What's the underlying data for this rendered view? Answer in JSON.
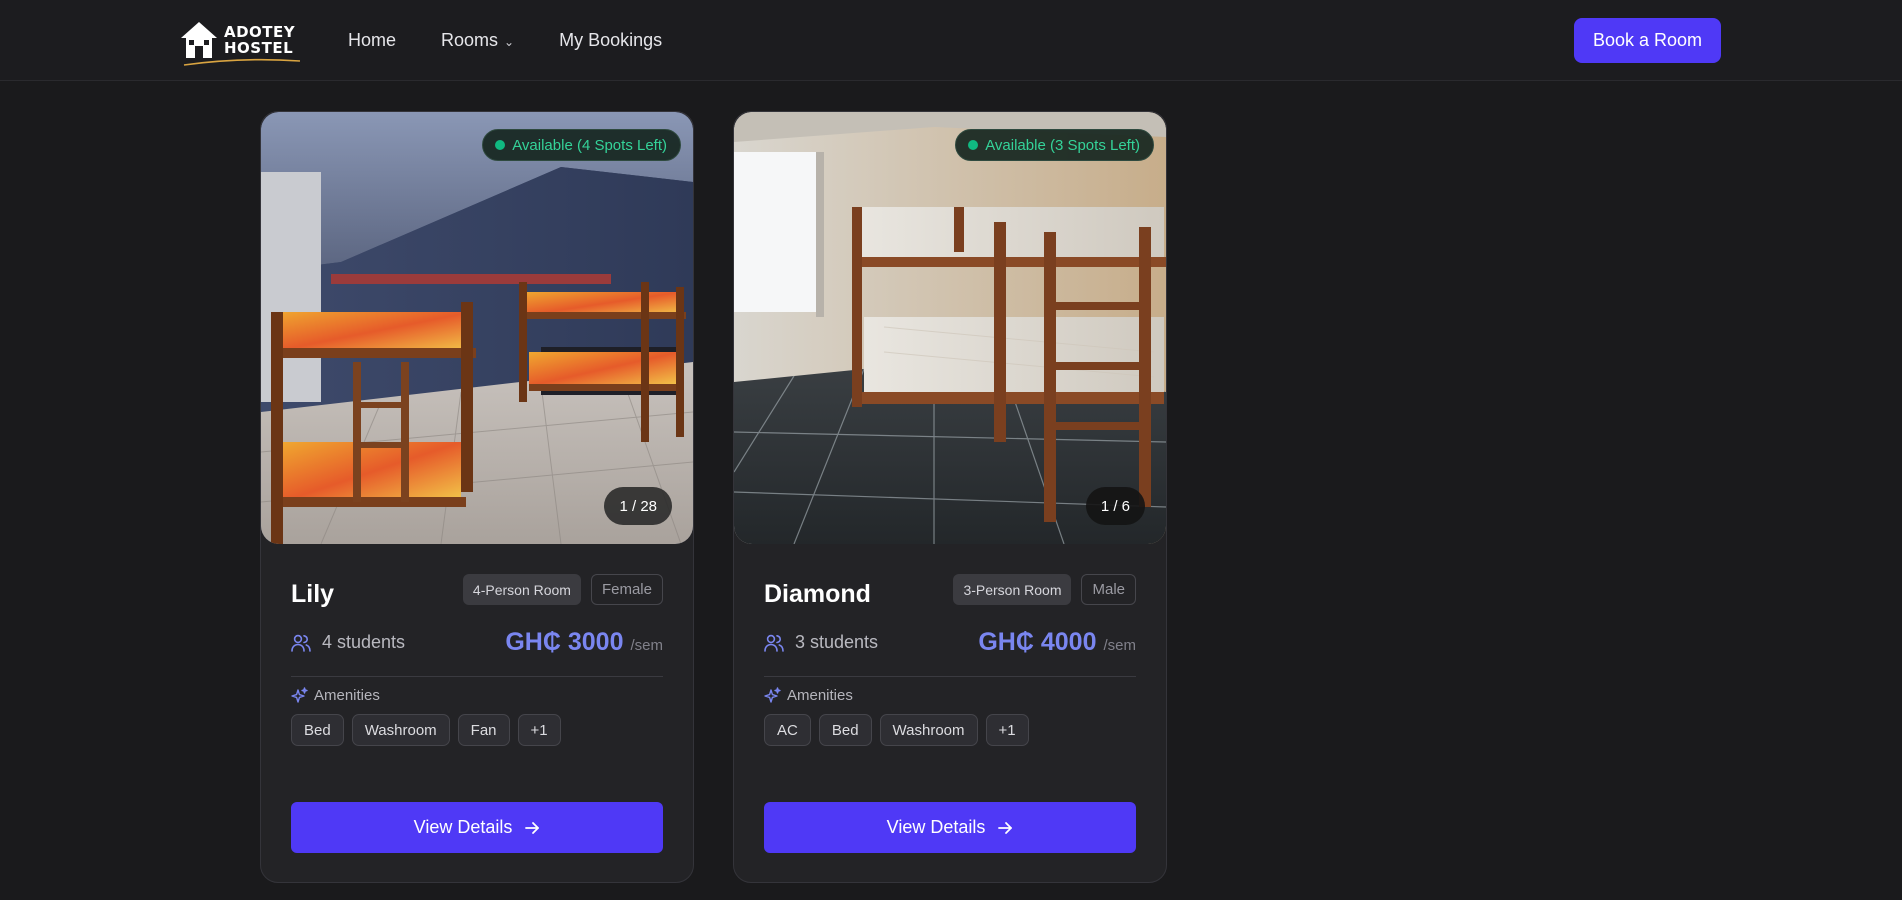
{
  "header": {
    "logo_line1": "ADOTEY",
    "logo_line2": "HOSTEL",
    "nav": [
      {
        "label": "Home"
      },
      {
        "label": "Rooms",
        "has_dropdown": true,
        "dropdown_icon": "chevron-down-icon"
      },
      {
        "label": "My Bookings"
      }
    ],
    "cta_label": "Book a Room"
  },
  "colors": {
    "accent": "#4f39f6",
    "price": "#7a86f0",
    "available": "#10b981",
    "background": "#1a1a1c",
    "card": "#232326"
  },
  "rooms": [
    {
      "name": "Lily",
      "availability": "Available (4 Spots Left)",
      "image_counter": "1 / 28",
      "type": "4-Person Room",
      "gender": "Female",
      "students": "4 students",
      "price": "GH₵ 3000",
      "price_unit": "/sem",
      "amenities_label": "Amenities",
      "amenities": [
        "Bed",
        "Washroom",
        "Fan",
        "+1"
      ],
      "button": "View Details"
    },
    {
      "name": "Diamond",
      "availability": "Available (3 Spots Left)",
      "image_counter": "1 / 6",
      "type": "3-Person Room",
      "gender": "Male",
      "students": "3 students",
      "price": "GH₵ 4000",
      "price_unit": "/sem",
      "amenities_label": "Amenities",
      "amenities": [
        "AC",
        "Bed",
        "Washroom",
        "+1"
      ],
      "button": "View Details"
    }
  ]
}
